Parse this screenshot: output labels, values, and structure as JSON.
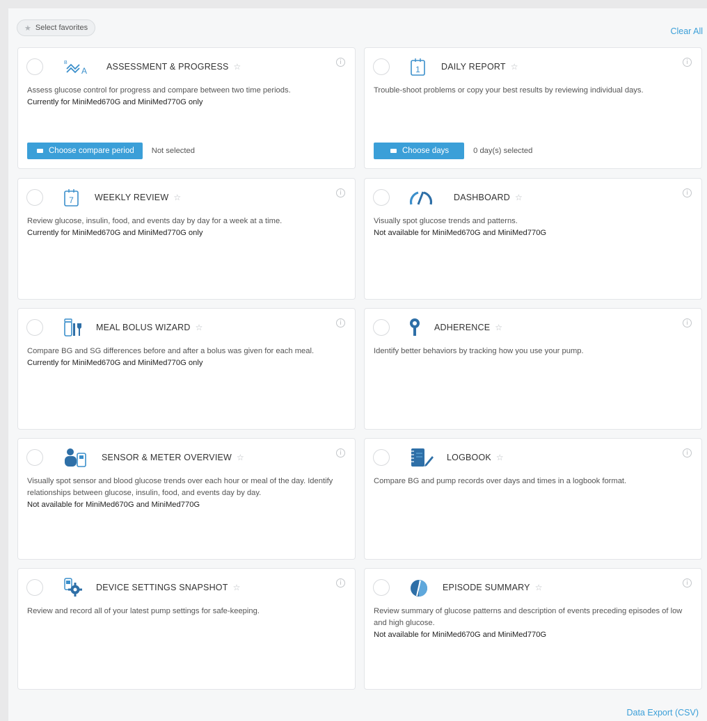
{
  "toolbar": {
    "select_favorites": "Select favorites",
    "clear_all": "Clear All"
  },
  "cards": [
    {
      "title": "ASSESSMENT & PROGRESS",
      "description": "Assess glucose control for progress and compare between two time periods.",
      "note": "Currently for MiniMed670G and MiniMed770G only",
      "button": "Choose compare period",
      "status": "Not selected",
      "icon": "trend-chart-icon"
    },
    {
      "title": "DAILY REPORT",
      "description": "Trouble-shoot problems or copy your best results by reviewing individual days.",
      "note": "",
      "button": "Choose days",
      "status": "0 day(s) selected",
      "icon": "calendar-day-icon"
    },
    {
      "title": "WEEKLY REVIEW",
      "description": "Review glucose, insulin, food, and events day by day for a week at a time.",
      "note": "Currently for MiniMed670G and MiniMed770G only",
      "icon": "calendar-week-icon"
    },
    {
      "title": "DASHBOARD",
      "description": "Visually spot glucose trends and patterns.",
      "note": "Not available for MiniMed670G and MiniMed770G",
      "icon": "gauge-icon"
    },
    {
      "title": "MEAL BOLUS WIZARD",
      "description": "Compare BG and SG differences before and after a bolus was given for each meal.",
      "note": "Currently for MiniMed670G and MiniMed770G only",
      "icon": "meal-icon"
    },
    {
      "title": "ADHERENCE",
      "description": "Identify better behaviors by tracking how you use your pump.",
      "note": "",
      "icon": "adherence-pin-icon"
    },
    {
      "title": "SENSOR & METER OVERVIEW",
      "description": "Visually spot sensor and blood glucose trends over each hour or meal of the day. Identify relationships between glucose, insulin, food, and events day by day.",
      "note": "Not available for MiniMed670G and MiniMed770G",
      "icon": "sensor-meter-icon"
    },
    {
      "title": "LOGBOOK",
      "description": "Compare BG and pump records over days and times in a logbook format.",
      "note": "",
      "icon": "logbook-icon"
    },
    {
      "title": "DEVICE SETTINGS SNAPSHOT",
      "description": "Review and record all of your latest pump settings for safe-keeping.",
      "note": "",
      "icon": "device-settings-icon"
    },
    {
      "title": "EPISODE SUMMARY",
      "description": "Review summary of glucose patterns and description of events preceding episodes of low and high glucose.",
      "note": "Not available for MiniMed670G and MiniMed770G",
      "icon": "episode-icon"
    }
  ],
  "calendar_days": {
    "daily": "1",
    "weekly": "7"
  },
  "footer": {
    "data_export": "Data Export (CSV)"
  },
  "colors": {
    "accent": "#3b9fd8",
    "icon": "#3b8fcb",
    "icon_dark": "#2e6fa7"
  }
}
